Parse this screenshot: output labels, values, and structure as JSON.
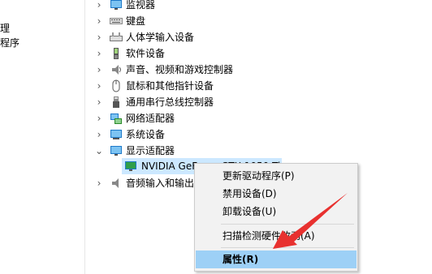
{
  "left_panel": {
    "items": [
      "理",
      "程序"
    ]
  },
  "tree": {
    "items": [
      {
        "label": "监视器",
        "icon": "monitor-icon",
        "expanded": false
      },
      {
        "label": "键盘",
        "icon": "keyboard-icon",
        "expanded": false
      },
      {
        "label": "人体学输入设备",
        "icon": "hid-icon",
        "expanded": false
      },
      {
        "label": "软件设备",
        "icon": "software-device-icon",
        "expanded": false
      },
      {
        "label": "声音、视频和游戏控制器",
        "icon": "speaker-icon",
        "expanded": false
      },
      {
        "label": "鼠标和其他指针设备",
        "icon": "mouse-icon",
        "expanded": false
      },
      {
        "label": "通用串行总线控制器",
        "icon": "usb-icon",
        "expanded": false
      },
      {
        "label": "网络适配器",
        "icon": "network-icon",
        "expanded": false
      },
      {
        "label": "系统设备",
        "icon": "system-device-icon",
        "expanded": false
      },
      {
        "label": "显示适配器",
        "icon": "display-adapter-icon",
        "expanded": true
      },
      {
        "label": "NVIDIA GeForce GTX 1050 Ti",
        "icon": "gpu-icon",
        "child": true
      },
      {
        "label": "音频输入和输出",
        "icon": "audio-io-icon",
        "expanded": false
      }
    ]
  },
  "context_menu": {
    "items": [
      {
        "label": "更新驱动程序(P)"
      },
      {
        "label": "禁用设备(D)"
      },
      {
        "label": "卸载设备(U)"
      },
      {
        "label": "扫描检测硬件改动(A)"
      },
      {
        "label": "属性(R)",
        "highlighted": true
      }
    ]
  },
  "colors": {
    "selection": "#cce8ff",
    "menu_bg": "#f2f2f2",
    "menu_highlight": "#9dd0f6",
    "arrow": "#e8312f"
  }
}
